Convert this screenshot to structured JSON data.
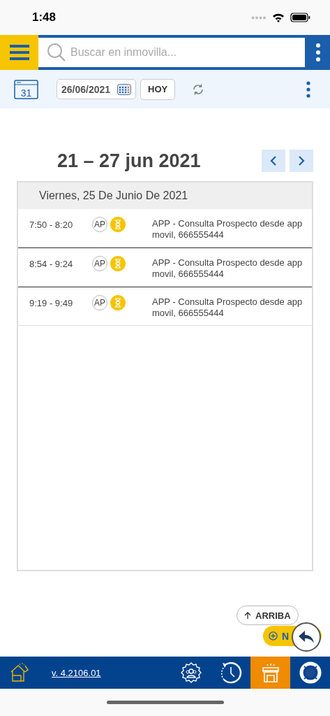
{
  "status_bar": {
    "time": "1:48"
  },
  "top_bar": {
    "search": {
      "placeholder": "Buscar en inmovilla..."
    }
  },
  "toolbar": {
    "calendar_day": "31",
    "date": "26/06/2021",
    "today_button": "HOY"
  },
  "week": {
    "title": "21 – 27 jun 2021"
  },
  "day": {
    "title": "Viernes, 25 De Junio De 2021",
    "events": [
      {
        "time": "7:50 - 8:20",
        "badge": "AP",
        "pending": true,
        "text": "APP - Consulta Prospecto desde app movil, 666555444"
      },
      {
        "time": "8:54 - 9:24",
        "badge": "AP",
        "pending": true,
        "text": "APP - Consulta Prospecto desde app movil, 666555444"
      },
      {
        "time": "9:19 - 9:49",
        "badge": "AP",
        "pending": true,
        "text": "APP - Consulta Prospecto desde app movil, 666555444"
      }
    ]
  },
  "floating": {
    "up_button": "ARRIBA",
    "new_button": "N"
  },
  "bottom_bar": {
    "version": "v. 4.2106.01",
    "items": [
      {
        "kind": "settings",
        "selected": false
      },
      {
        "kind": "history",
        "selected": false
      },
      {
        "kind": "shop",
        "selected": true
      },
      {
        "kind": "help",
        "selected": false
      }
    ]
  }
}
